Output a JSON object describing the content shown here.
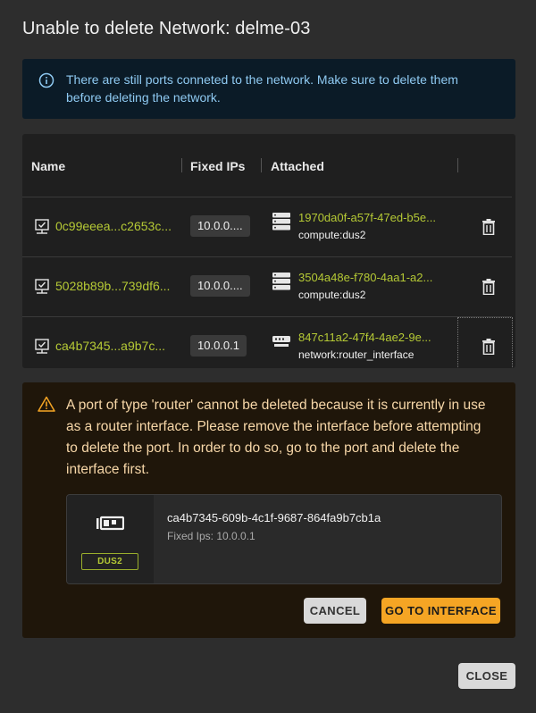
{
  "dialog": {
    "title": "Unable to delete Network: delme-03",
    "info_message": "There are still ports conneted to the network. Make sure to delete them before deleting the network.",
    "close_label": "CLOSE"
  },
  "table": {
    "columns": [
      "Name",
      "Fixed IPs",
      "Attached"
    ],
    "rows": [
      {
        "name": "0c99eeea...c2653c...",
        "fixed_ip": "10.0.0....",
        "attached_id": "1970da0f-a57f-47ed-b5e...",
        "attached_owner": "compute:dus2",
        "host_icon": "server-icon"
      },
      {
        "name": "5028b89b...739df6...",
        "fixed_ip": "10.0.0....",
        "attached_id": "3504a48e-f780-4aa1-a2...",
        "attached_owner": "compute:dus2",
        "host_icon": "server-icon"
      },
      {
        "name": "ca4b7345...a9b7c...",
        "fixed_ip": "10.0.0.1",
        "attached_id": "847c11a2-47f4-4ae2-9e...",
        "attached_owner": "network:router_interface",
        "host_icon": "router-icon"
      }
    ]
  },
  "warning": {
    "message": "A port of type 'router' cannot be deleted because it is currently in use as a router interface. Please remove the interface before attempting to delete the port. In order to do so, go to the port and delete the interface first.",
    "port": {
      "id": "ca4b7345-609b-4c1f-9687-864fa9b7cb1a",
      "fixed_ips": "Fixed Ips: 10.0.0.1",
      "region": "DUS2"
    },
    "cancel_label": "CANCEL",
    "go_label": "GO TO INTERFACE"
  },
  "colors": {
    "accent_green": "#b5c935",
    "info_blue": "#8fcaf2",
    "warning_orange": "#f5a524",
    "background": "#2d2d2d"
  }
}
